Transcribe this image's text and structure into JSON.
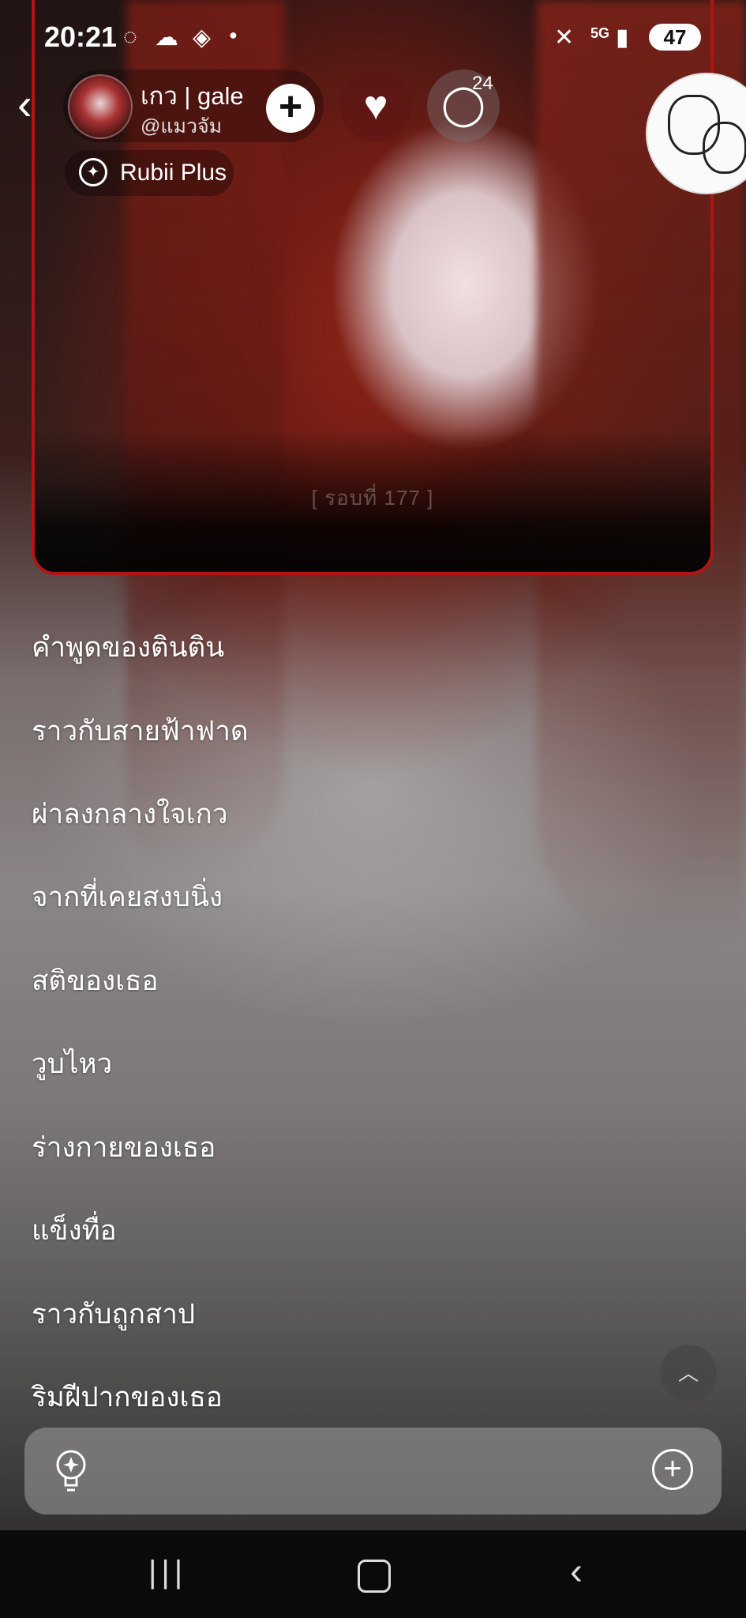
{
  "status_bar": {
    "time": "20:21",
    "icons": [
      "messenger-icon",
      "cloud-icon",
      "diamond-icon",
      "dot-icon",
      "mute-icon",
      "5g-icon",
      "signal-icon"
    ],
    "network": "5G",
    "battery": "47"
  },
  "header": {
    "username": "เกว | gale",
    "handle": "@แมวจัม",
    "comment_count": "24",
    "badge_label": "Rubii Plus"
  },
  "card": {
    "round_label": "[ รอบที่ 177 ]"
  },
  "options": [
    "คำพูดของตินติน",
    "ราวกับสายฟ้าฟาด",
    "ผ่าลงกลางใจเกว",
    "จากที่เคยสงบนิ่ง",
    "สติของเธอ",
    "วูบไหว",
    "ร่างกายของเธอ",
    "แข็งทื่อ",
    "ราวกับถูกสาป",
    "ริมฝีปากของเธอ"
  ],
  "colors": {
    "card_border": "#b21414",
    "navbar": "#0a0a0a"
  }
}
